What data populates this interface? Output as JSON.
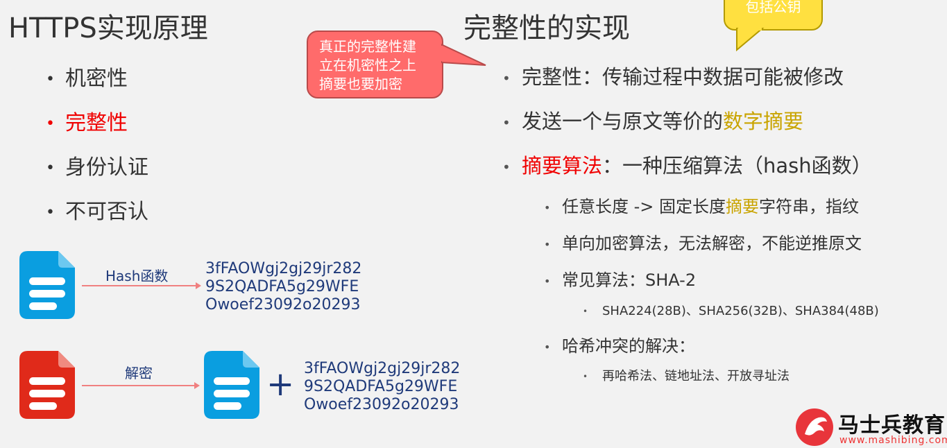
{
  "left": {
    "title": "HTTPS实现原理",
    "bullets": [
      "机密性",
      "完整性",
      "身份认证",
      "不可否认"
    ]
  },
  "right": {
    "title": "完整性的实现",
    "b1": "完整性：传输过程中数据可能被修改",
    "b2_prefix": "发送一个与原文等价的",
    "b2_highlight": "数字摘要",
    "b3_red": "摘要算法",
    "b3_rest": "：一种压缩算法（hash函数）",
    "s1_prefix": "任意长度 -> 固定长度",
    "s1_highlight": "摘要",
    "s1_suffix": "字符串，指纹",
    "s2": "单向加密算法，无法解密，不能逆推原文",
    "s3": "常见算法：SHA-2",
    "s3a": "SHA224(28B)、SHA256(32B)、SHA384(48B)",
    "s4": "哈希冲突的解决：",
    "s4a": "再哈希法、链地址法、开放寻址法"
  },
  "callouts": {
    "red_lines": [
      "真正的完整性建",
      "立在机密性之上",
      "摘要也要加密"
    ],
    "yellow": "包括公钥"
  },
  "diagram": {
    "hash_label": "Hash函数",
    "decrypt_label": "解密",
    "plus": "+",
    "digest_lines": [
      "3fFAOWgj2gj29jr282",
      "9S2QADFA5g29WFE",
      "Owoef23092o20293"
    ]
  },
  "logo": {
    "name": "马士兵教育",
    "url": "www.mashibing.com"
  },
  "colors": {
    "blue_doc": "#0a9ee0",
    "red_doc": "#e02a1a",
    "accent_red": "#f00000",
    "accent_gold": "#c9a400"
  }
}
